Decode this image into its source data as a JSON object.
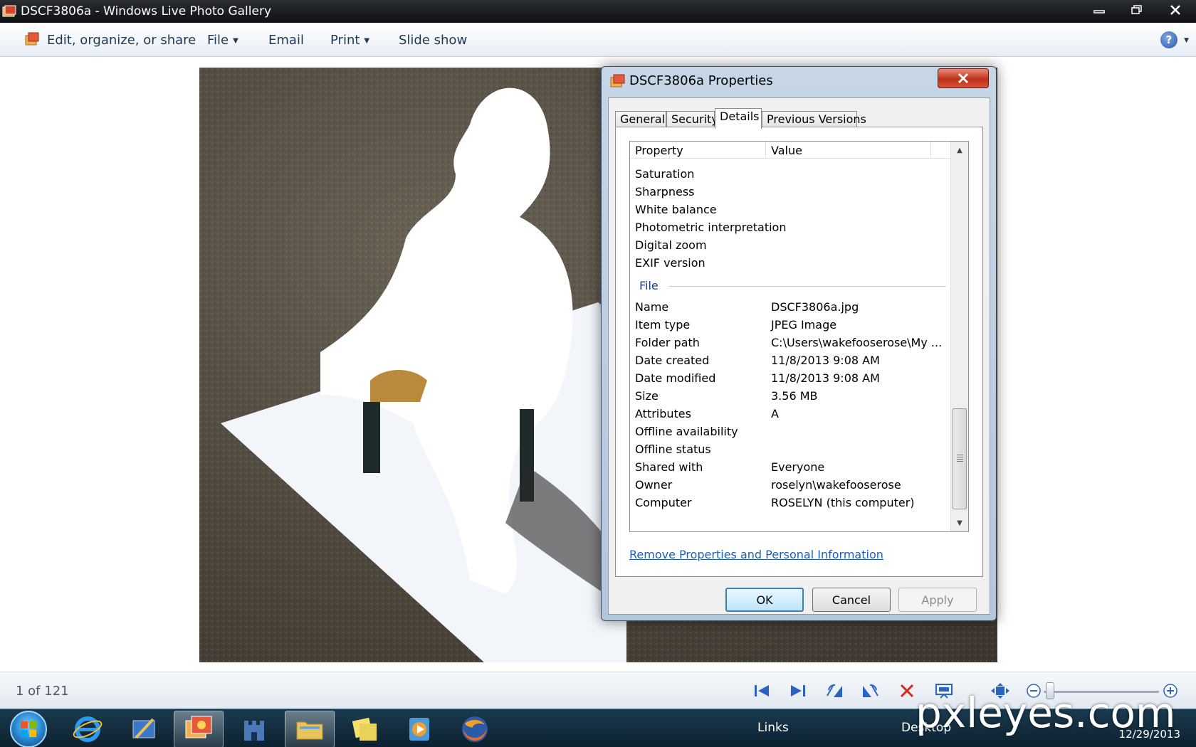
{
  "window": {
    "title": "DSCF3806a - Windows Live Photo Gallery"
  },
  "commandbar": {
    "edit_label": "Edit, organize, or share",
    "file_label": "File",
    "email_label": "Email",
    "print_label": "Print",
    "slideshow_label": "Slide show"
  },
  "dialog": {
    "title": "DSCF3806a Properties",
    "tabs": [
      {
        "label": "General"
      },
      {
        "label": "Security"
      },
      {
        "label": "Details"
      },
      {
        "label": "Previous Versions"
      }
    ],
    "active_tab": "Details",
    "columns": {
      "property": "Property",
      "value": "Value"
    },
    "camera_rows": [
      {
        "property": "Saturation",
        "value": ""
      },
      {
        "property": "Sharpness",
        "value": ""
      },
      {
        "property": "White balance",
        "value": ""
      },
      {
        "property": "Photometric interpretation",
        "value": ""
      },
      {
        "property": "Digital zoom",
        "value": ""
      },
      {
        "property": "EXIF version",
        "value": ""
      }
    ],
    "file_group": "File",
    "file_rows": [
      {
        "property": "Name",
        "value": "DSCF3806a.jpg"
      },
      {
        "property": "Item type",
        "value": "JPEG Image"
      },
      {
        "property": "Folder path",
        "value": "C:\\Users\\wakefooserose\\My ..."
      },
      {
        "property": "Date created",
        "value": "11/8/2013 9:08 AM"
      },
      {
        "property": "Date modified",
        "value": "11/8/2013 9:08 AM"
      },
      {
        "property": "Size",
        "value": "3.56 MB"
      },
      {
        "property": "Attributes",
        "value": "A"
      },
      {
        "property": "Offline availability",
        "value": ""
      },
      {
        "property": "Offline status",
        "value": ""
      },
      {
        "property": "Shared with",
        "value": "Everyone"
      },
      {
        "property": "Owner",
        "value": "roselyn\\wakefooserose"
      },
      {
        "property": "Computer",
        "value": "ROSELYN (this computer)"
      }
    ],
    "remove_link": "Remove Properties and Personal Information",
    "buttons": {
      "ok": "OK",
      "cancel": "Cancel",
      "apply": "Apply"
    }
  },
  "statusbar": {
    "counter": "1 of 121"
  },
  "taskbar": {
    "links_label": "Links",
    "desktop_label": "Desktop",
    "date": "12/29/2013"
  },
  "watermark": "pxleyes.com",
  "colors": {
    "link": "#1d5eb8",
    "group_header": "#1e3f8c",
    "close_button": "#c0301a",
    "taskbar": "#0c2130"
  }
}
